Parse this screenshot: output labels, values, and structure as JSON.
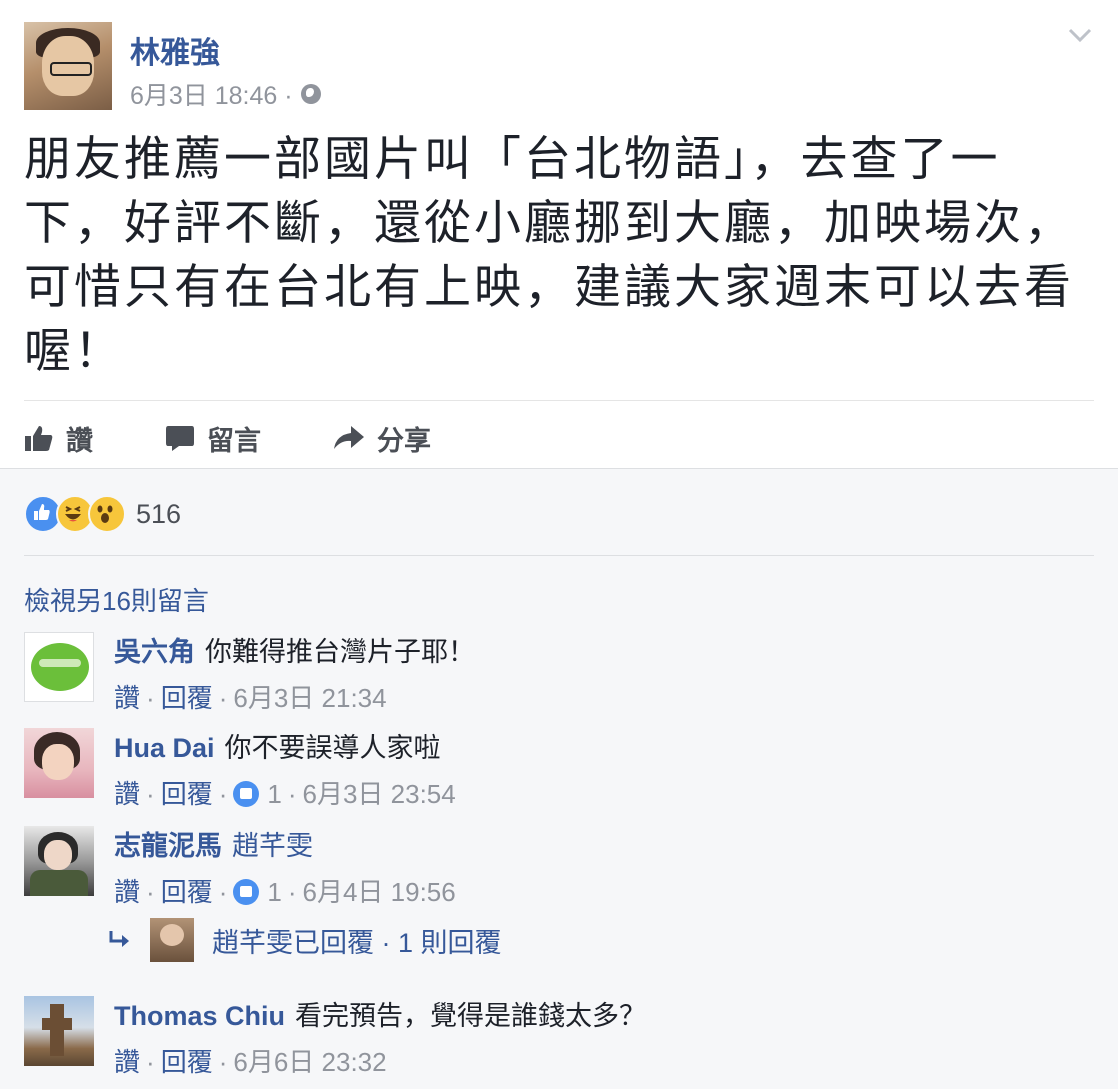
{
  "post": {
    "author": "林雅強",
    "timestamp": "6月3日 18:46 ·",
    "text": "朋友推薦一部國片叫「台北物語」，去查了一下，好評不斷，還從小廳挪到大廳，加映場次，可惜只有在台北有上映，建議大家週末可以去看喔！",
    "actions": {
      "like": "讚",
      "comment": "留言",
      "share": "分享"
    }
  },
  "reactions": {
    "count": "516",
    "types": [
      "like-icon",
      "haha-icon",
      "wow-icon"
    ],
    "accent": "#4a90f0"
  },
  "comments": {
    "view_more": "檢視另16則留言",
    "items": [
      {
        "name": "吳六角",
        "text": "你難得推台灣片子耶！",
        "like": "讚",
        "reply": "回覆",
        "time": "6月3日 21:34"
      },
      {
        "name": "Hua Dai",
        "text": "你不要誤導人家啦",
        "like": "讚",
        "reply": "回覆",
        "likes": "1",
        "time": "6月3日 23:54"
      },
      {
        "name": "志龍泥馬",
        "tag": "趙芊雯",
        "like": "讚",
        "reply": "回覆",
        "likes": "1",
        "time": "6月4日 19:56",
        "reply_summary": "趙芊雯已回覆 · 1 則回覆"
      },
      {
        "name": "Thomas Chiu",
        "text": "看完預告，覺得是誰錢太多？",
        "like": "讚",
        "reply": "回覆",
        "time": "6月6日 23:32"
      }
    ]
  },
  "colors": {
    "link": "#365899",
    "meta": "#90949c",
    "text": "#1d2129",
    "background": "#f6f7f9"
  }
}
